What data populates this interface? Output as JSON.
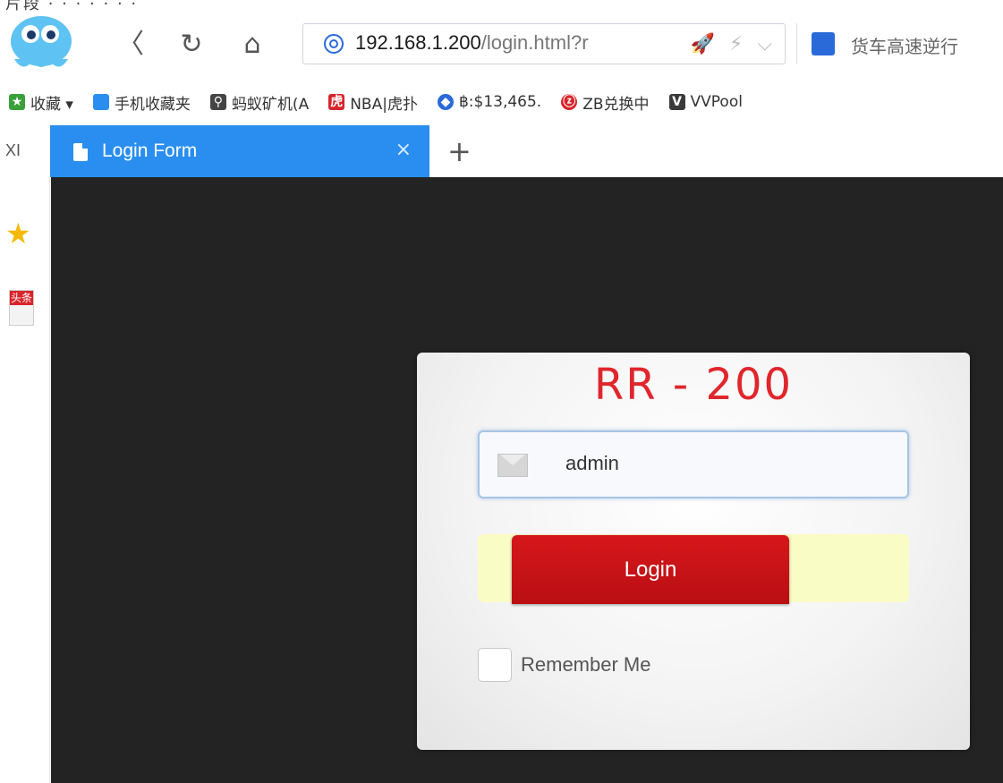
{
  "browser": {
    "address": {
      "host": "192.168.1.200",
      "path": "/login.html?r"
    },
    "search_text": "货车高速逆行",
    "nav": {
      "back_symbol": "〈",
      "reload_symbol": "↻",
      "home_symbol": "⌂"
    },
    "bookmarks": [
      {
        "label": "收藏 ▾",
        "icon": "bookmark-star-icon"
      },
      {
        "label": "手机收藏夹",
        "icon": "phone-icon"
      },
      {
        "label": "蚂蚁矿机(A",
        "icon": "ant-miner-icon"
      },
      {
        "label": "NBA|虎扑",
        "icon": "hupu-tiger-icon"
      },
      {
        "label": "฿:$13,465.",
        "icon": "bitcoin-icon"
      },
      {
        "label": "ZB兑换中",
        "icon": "zb-icon"
      },
      {
        "label": "VVPool",
        "icon": "vvpool-icon"
      }
    ],
    "tabs": [
      {
        "title": "Login Form",
        "active": true
      }
    ],
    "tab_cut_label": "XI",
    "tab_close_symbol": "×",
    "new_tab_symbol": "+"
  },
  "side_panel": {
    "news_label": "头条"
  },
  "login": {
    "brand": "RR - 200",
    "username_value": "admin",
    "password_mask": "•••••",
    "remember_label": "Remember Me",
    "remember_checked": false,
    "submit_label": "Login"
  },
  "colors": {
    "tab_active": "#2a8ef0",
    "brand": "#e0262c",
    "login_button": "#c8141a",
    "page_bg": "#232323",
    "password_bg": "#fafcc6"
  }
}
